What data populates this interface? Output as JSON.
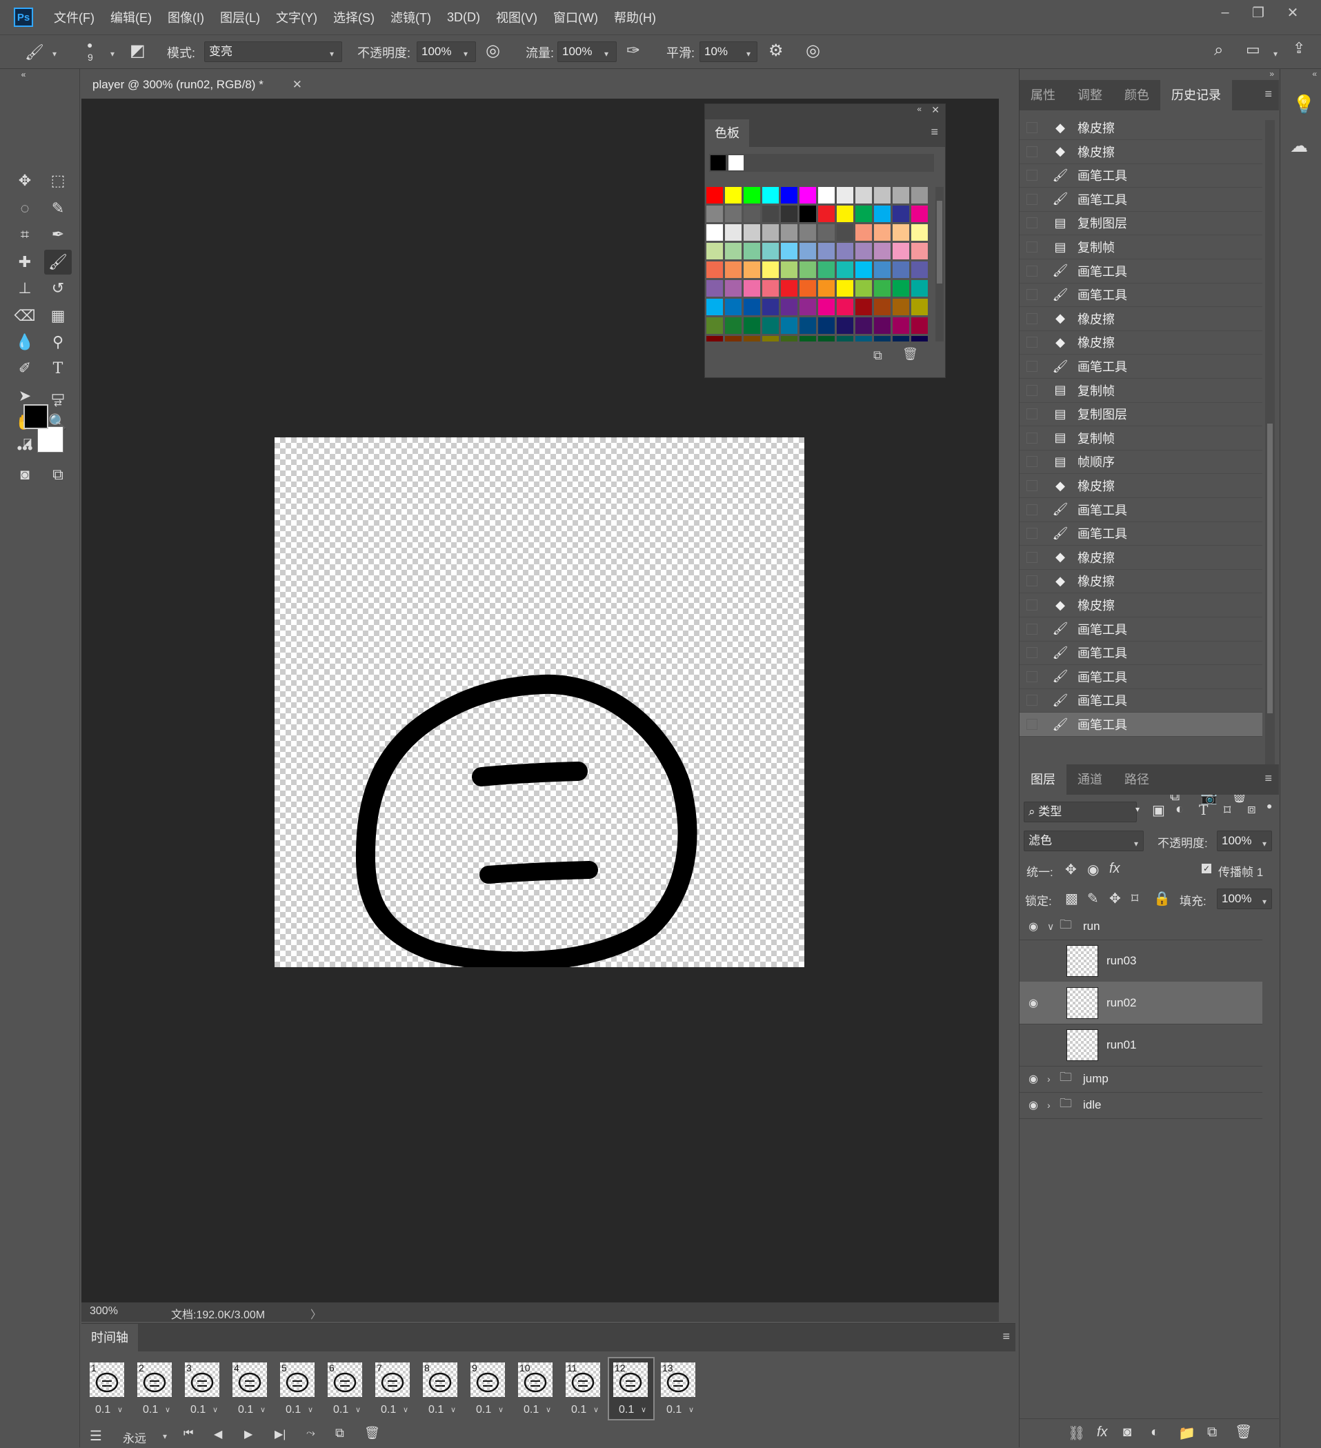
{
  "app": {
    "logo": "Ps"
  },
  "menu": [
    "文件(F)",
    "编辑(E)",
    "图像(I)",
    "图层(L)",
    "文字(Y)",
    "选择(S)",
    "滤镜(T)",
    "3D(D)",
    "视图(V)",
    "窗口(W)",
    "帮助(H)"
  ],
  "options": {
    "brush_size": "9",
    "mode_label": "模式:",
    "mode_value": "变亮",
    "opacity_label": "不透明度:",
    "opacity_value": "100%",
    "flow_label": "流量:",
    "flow_value": "100%",
    "smooth_label": "平滑:",
    "smooth_value": "10%"
  },
  "document": {
    "tab_title": "player @ 300% (run02, RGB/8) *",
    "zoom": "300%",
    "doc_info": "文档:192.0K/3.00M"
  },
  "swatches": {
    "title": "色板",
    "colors": [
      [
        "#ff0000",
        "#ffff00",
        "#00ff00",
        "#00ffff",
        "#0000ff",
        "#ff00ff",
        "#ffffff",
        "#ebebeb",
        "#d6d6d6",
        "#c2c2c2",
        "#adadad",
        "#999999"
      ],
      [
        "#858585",
        "#707070",
        "#5c5c5c",
        "#474747",
        "#333333",
        "#000000",
        "#ee1d24",
        "#fff200",
        "#00a650",
        "#00adef",
        "#2e3192",
        "#ec008c"
      ],
      [
        "#ffffff",
        "#e6e6e6",
        "#cccccc",
        "#b3b3b3",
        "#999999",
        "#808080",
        "#666666",
        "#4d4d4d",
        "#f7977a",
        "#fbad82",
        "#fdc68c",
        "#fff799"
      ],
      [
        "#c6df9c",
        "#a4d49d",
        "#81ca9d",
        "#7bcdc9",
        "#6ccff7",
        "#7ea7d8",
        "#8493ca",
        "#8882be",
        "#a286bd",
        "#bc8cbf",
        "#f49bc1",
        "#f5999d"
      ],
      [
        "#f16c4d",
        "#f68e54",
        "#fbaf5a",
        "#fff467",
        "#acd372",
        "#7dc473",
        "#39b778",
        "#16bcb4",
        "#00bff3",
        "#438ccb",
        "#5573b7",
        "#5e5ca7"
      ],
      [
        "#855fa8",
        "#a763a9",
        "#ef6ea8",
        "#f16d7e",
        "#ee1d24",
        "#f16522",
        "#f7941d",
        "#fff100",
        "#8fc63d",
        "#37b44a",
        "#00a650",
        "#00a99e"
      ],
      [
        "#00aeef",
        "#0072bc",
        "#0054a5",
        "#2f3192",
        "#652c91",
        "#91278f",
        "#ed008c",
        "#ee105a",
        "#9d0a0f",
        "#a1410d",
        "#a36209",
        "#aba000"
      ],
      [
        "#588528",
        "#197b30",
        "#007236",
        "#00736a",
        "#0076a4",
        "#004a80",
        "#003370",
        "#1d1363",
        "#450e61",
        "#62055f",
        "#9e005c",
        "#9d0039"
      ],
      [
        "#790000",
        "#7b3000",
        "#7c4900",
        "#827a00",
        "#3e6617",
        "#045f20",
        "#005824",
        "#005951",
        "#005b7e",
        "#003562",
        "#002056",
        "#0c004b"
      ]
    ]
  },
  "right_tabs": [
    "属性",
    "调整",
    "颜色",
    "历史记录"
  ],
  "history": [
    {
      "icon": "eraser",
      "label": "橡皮擦"
    },
    {
      "icon": "eraser",
      "label": "橡皮擦"
    },
    {
      "icon": "brush",
      "label": "画笔工具"
    },
    {
      "icon": "brush",
      "label": "画笔工具"
    },
    {
      "icon": "doc",
      "label": "复制图层"
    },
    {
      "icon": "doc",
      "label": "复制帧"
    },
    {
      "icon": "brush",
      "label": "画笔工具"
    },
    {
      "icon": "brush",
      "label": "画笔工具"
    },
    {
      "icon": "eraser",
      "label": "橡皮擦"
    },
    {
      "icon": "eraser",
      "label": "橡皮擦"
    },
    {
      "icon": "brush",
      "label": "画笔工具"
    },
    {
      "icon": "doc",
      "label": "复制帧"
    },
    {
      "icon": "doc",
      "label": "复制图层"
    },
    {
      "icon": "doc",
      "label": "复制帧"
    },
    {
      "icon": "doc",
      "label": "帧顺序"
    },
    {
      "icon": "eraser",
      "label": "橡皮擦"
    },
    {
      "icon": "brush",
      "label": "画笔工具"
    },
    {
      "icon": "brush",
      "label": "画笔工具"
    },
    {
      "icon": "eraser",
      "label": "橡皮擦"
    },
    {
      "icon": "eraser",
      "label": "橡皮擦"
    },
    {
      "icon": "eraser",
      "label": "橡皮擦"
    },
    {
      "icon": "brush",
      "label": "画笔工具"
    },
    {
      "icon": "brush",
      "label": "画笔工具"
    },
    {
      "icon": "brush",
      "label": "画笔工具"
    },
    {
      "icon": "brush",
      "label": "画笔工具"
    },
    {
      "icon": "brush",
      "label": "画笔工具"
    }
  ],
  "layers_tabs": [
    "图层",
    "通道",
    "路径"
  ],
  "layers_panel": {
    "filter_kind": "类型",
    "blend_mode": "滤色",
    "opacity_label": "不透明度:",
    "opacity_value": "100%",
    "unify_label": "统一:",
    "propagate_label": "传播帧 1",
    "lock_label": "锁定:",
    "fill_label": "填充:",
    "fill_value": "100%"
  },
  "layers": [
    {
      "name": "run",
      "type": "group",
      "visible": true,
      "expanded": true
    },
    {
      "name": "run03",
      "type": "layer",
      "visible": false
    },
    {
      "name": "run02",
      "type": "layer",
      "visible": true,
      "selected": true
    },
    {
      "name": "run01",
      "type": "layer",
      "visible": false
    },
    {
      "name": "jump",
      "type": "group",
      "visible": true,
      "expanded": false
    },
    {
      "name": "idle",
      "type": "group",
      "visible": true,
      "expanded": false
    }
  ],
  "timeline": {
    "title": "时间轴",
    "loop": "永远",
    "frames": [
      {
        "n": "1",
        "d": "0.1"
      },
      {
        "n": "2",
        "d": "0.1"
      },
      {
        "n": "3",
        "d": "0.1"
      },
      {
        "n": "4",
        "d": "0.1"
      },
      {
        "n": "5",
        "d": "0.1"
      },
      {
        "n": "6",
        "d": "0.1"
      },
      {
        "n": "7",
        "d": "0.1"
      },
      {
        "n": "8",
        "d": "0.1"
      },
      {
        "n": "9",
        "d": "0.1"
      },
      {
        "n": "10",
        "d": "0.1"
      },
      {
        "n": "11",
        "d": "0.1"
      },
      {
        "n": "12",
        "d": "0.1",
        "selected": true
      },
      {
        "n": "13",
        "d": "0.1"
      }
    ]
  }
}
